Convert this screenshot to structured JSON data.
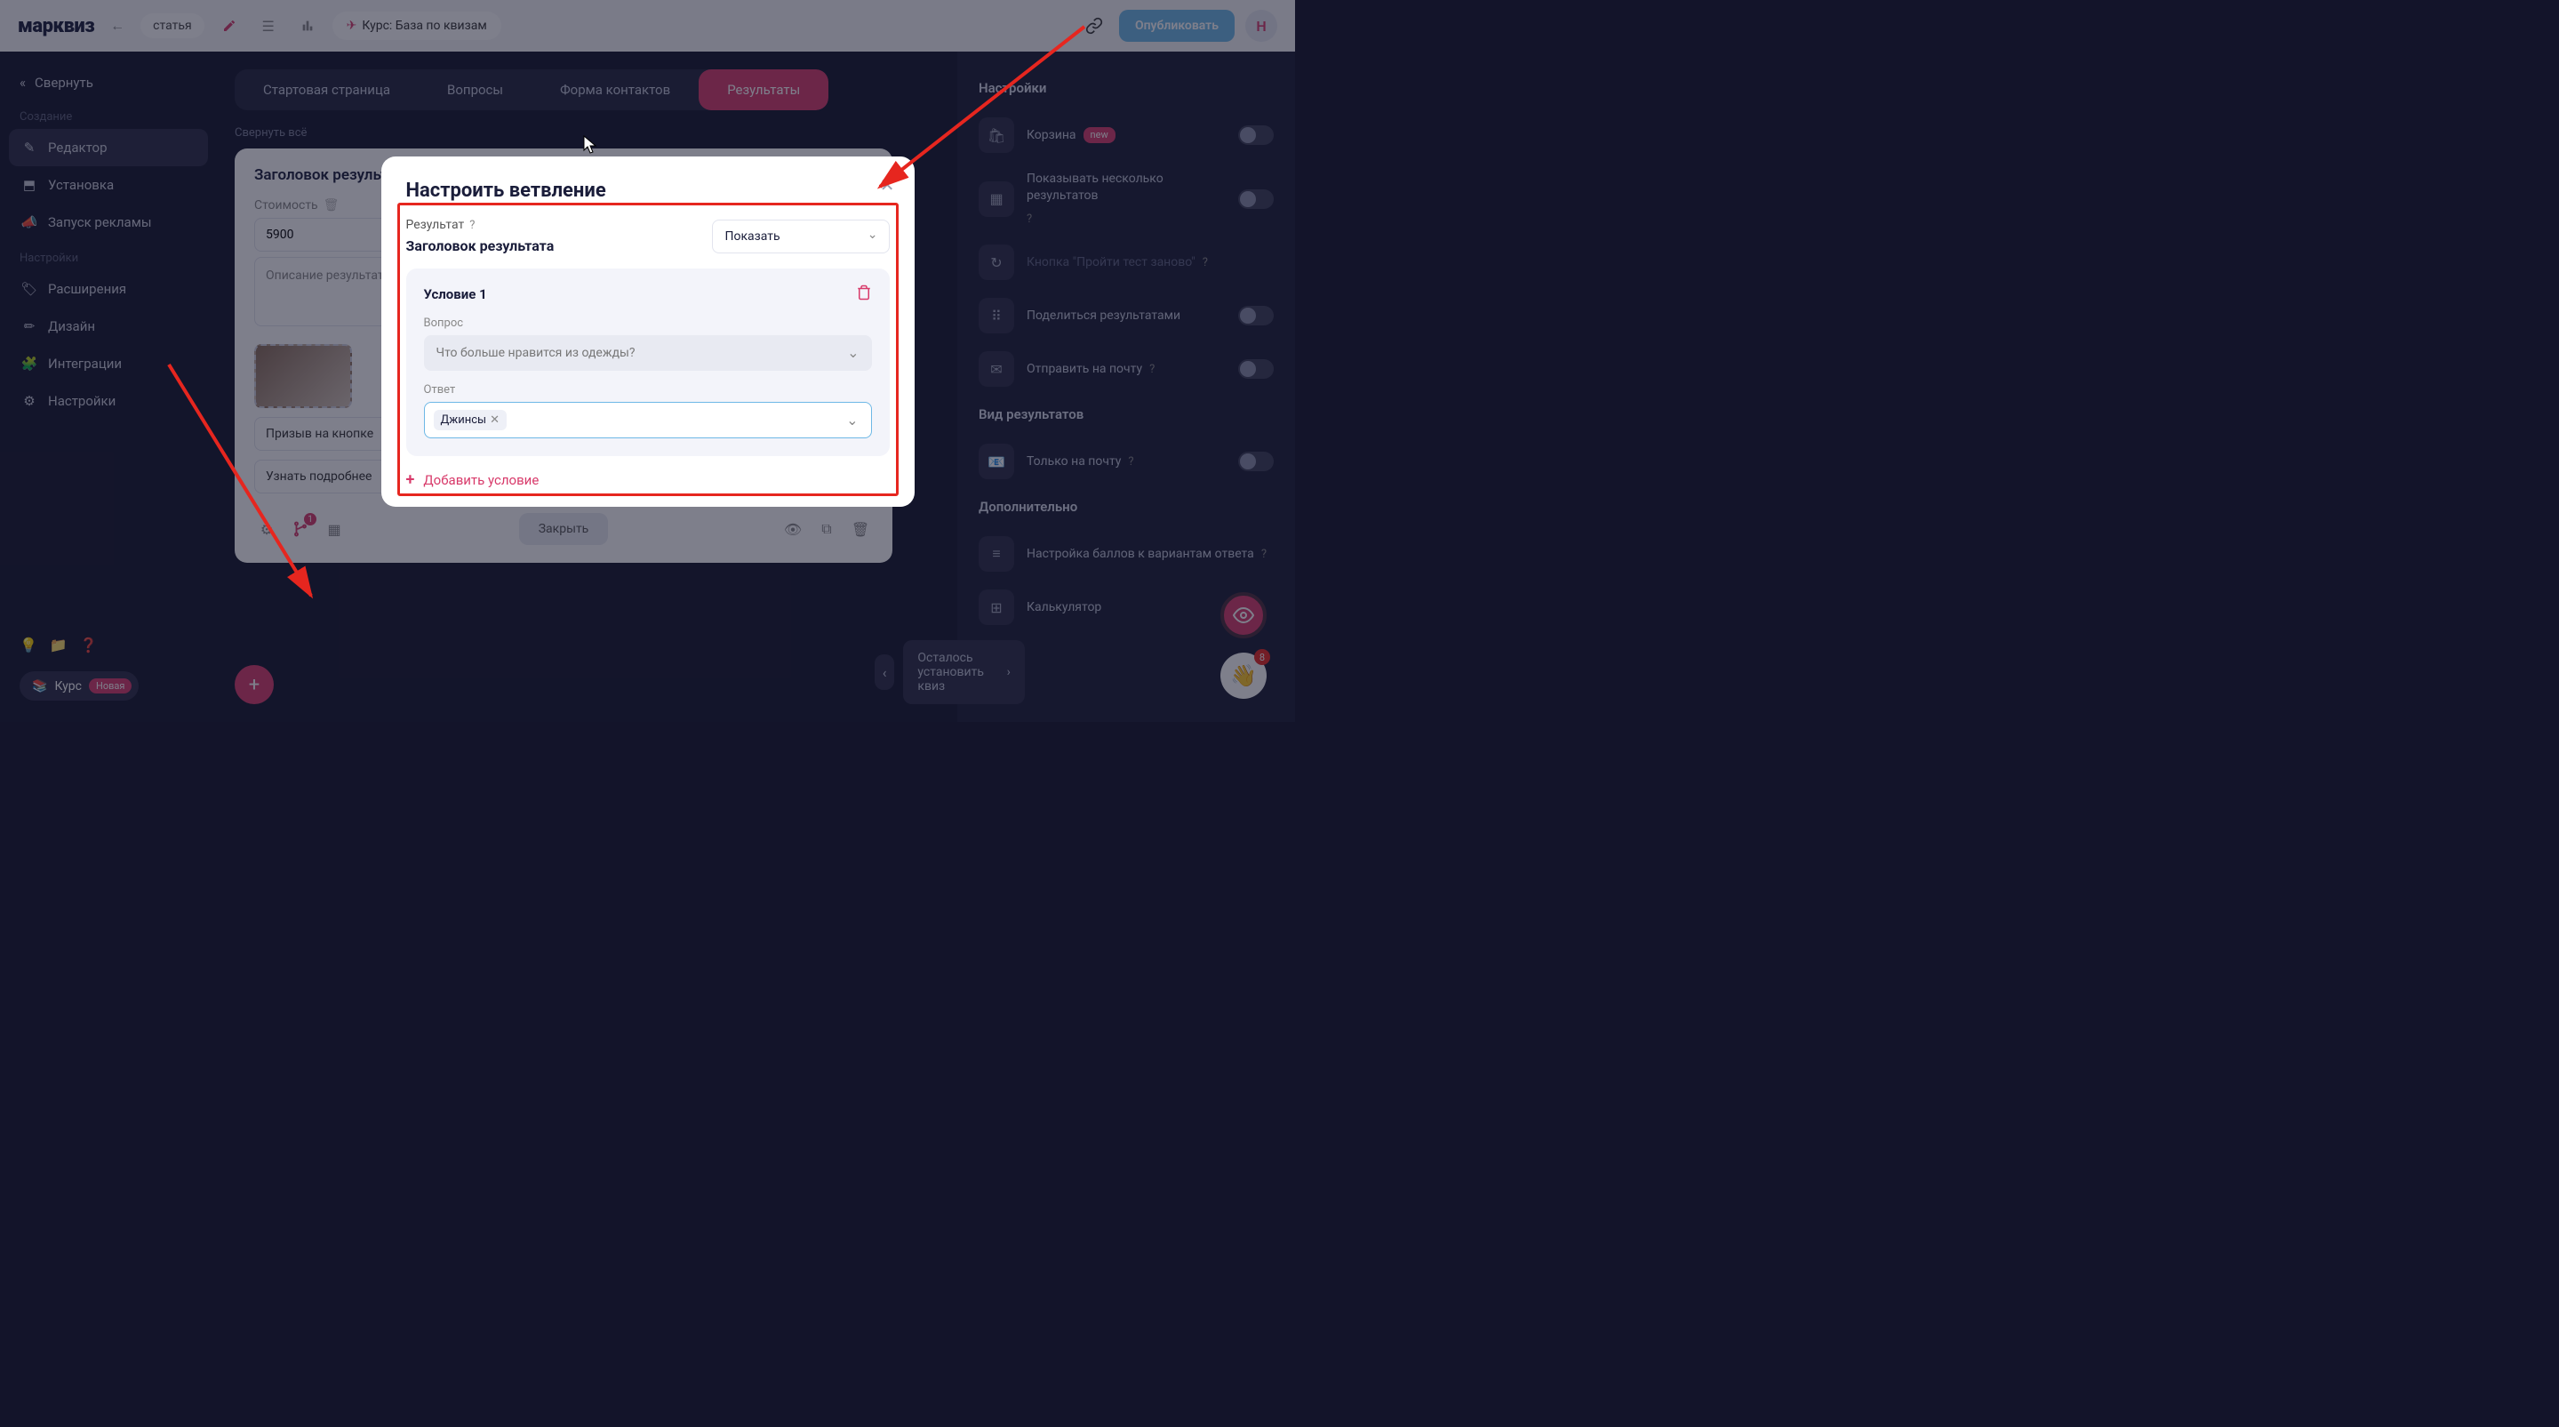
{
  "header": {
    "logo": "марквиз",
    "breadcrumb": "статья",
    "course_pill": "Курс: База по квизам",
    "publish": "Опубликовать",
    "avatar_initial": "Н"
  },
  "sidebar": {
    "collapse": "Свернуть",
    "section_create": "Создание",
    "section_settings": "Настройки",
    "items_create": [
      {
        "label": "Редактор"
      },
      {
        "label": "Установка"
      },
      {
        "label": "Запуск рекламы"
      }
    ],
    "items_settings": [
      {
        "label": "Расширения"
      },
      {
        "label": "Дизайн"
      },
      {
        "label": "Интеграции"
      },
      {
        "label": "Настройки"
      }
    ],
    "course_btn": "Курс",
    "course_badge": "Новая"
  },
  "tabs": {
    "items": [
      "Стартовая страница",
      "Вопросы",
      "Форма контактов",
      "Результаты"
    ],
    "collapse_all": "Свернуть всё"
  },
  "result_card": {
    "title": "Заголовок результата",
    "cost_label": "Стоимость",
    "cost_value": "5900",
    "desc_placeholder": "Описание результата",
    "cta_label": "Призыв на кнопке",
    "learn_label": "Узнать подробнее",
    "close": "Закрыть"
  },
  "right_panel": {
    "heading1": "Настройки",
    "rows1": [
      {
        "label": "Корзина",
        "badge": "new",
        "toggle": true
      },
      {
        "label": "Показывать несколько результатов",
        "help": true,
        "toggle": true
      },
      {
        "label": "Кнопка \"Пройти тест заново\"",
        "help": true,
        "dim": true
      },
      {
        "label": "Поделиться результатами",
        "toggle": true
      },
      {
        "label": "Отправить на почту",
        "help": true,
        "toggle": true
      }
    ],
    "heading2": "Вид результатов",
    "rows2": [
      {
        "label": "Только на почту",
        "help": true,
        "toggle": true
      }
    ],
    "heading3": "Дополнительно",
    "rows3": [
      {
        "label": "Настройка баллов к вариантам ответа",
        "help": true
      },
      {
        "label": "Калькулятор"
      }
    ]
  },
  "modal": {
    "title": "Настроить ветвление",
    "result_label": "Результат",
    "show_select": "Показать",
    "result_subtitle": "Заголовок результата",
    "condition_title": "Условие 1",
    "question_label": "Вопрос",
    "question_value": "Что больше нравится из одежды?",
    "answer_label": "Ответ",
    "answer_chip": "Джинсы",
    "add_condition": "Добавить условие"
  },
  "pager": {
    "text": "Осталось установить квиз"
  },
  "chat_badge": "8"
}
